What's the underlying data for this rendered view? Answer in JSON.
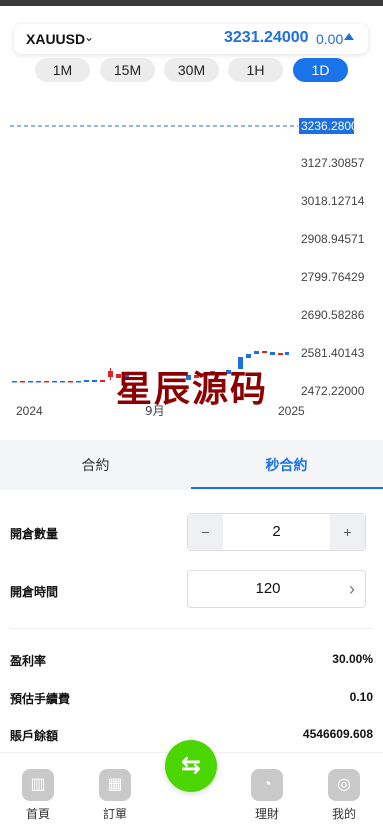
{
  "ticker": {
    "symbol": "XAUUSD",
    "price": "3231.24000",
    "change": "0.00",
    "accent": "#1e6fe0"
  },
  "intervals": [
    {
      "label": "1M",
      "active": false
    },
    {
      "label": "15M",
      "active": false
    },
    {
      "label": "30M",
      "active": false
    },
    {
      "label": "1H",
      "active": false
    },
    {
      "label": "1D",
      "active": true
    }
  ],
  "chart": {
    "current_price_label": "3236.28000",
    "y_ticks": [
      "3127.30857",
      "3018.12714",
      "2908.94571",
      "2799.76429",
      "2690.58286",
      "2581.40143",
      "2472.22000"
    ],
    "x_ticks": [
      "2024",
      "9月",
      "2025"
    ],
    "watermark": "星辰源码"
  },
  "chart_data": {
    "type": "candlestick",
    "ylim": [
      2472.22,
      3236.28
    ],
    "y_ticks": [
      3127.30857,
      3018.12714,
      2908.94571,
      2799.76429,
      2690.58286,
      2581.40143,
      2472.22
    ],
    "current_price": 3236.28,
    "x_ticks": [
      "2024",
      "9月",
      "2025"
    ],
    "up_color": "#1e6fe0",
    "down_color": "#e02424"
  },
  "tabs": [
    {
      "label": "合約",
      "active": false
    },
    {
      "label": "秒合約",
      "active": true
    }
  ],
  "form": {
    "qty_label": "開倉數量",
    "qty_minus": "−",
    "qty_value": "2",
    "qty_plus": "+",
    "time_label": "開倉時間",
    "time_value": "120",
    "time_chevron": "›"
  },
  "info": {
    "profit_rate_label": "盈利率",
    "profit_rate_value": "30.00%",
    "fee_label": "預估手續費",
    "fee_value": "0.10",
    "balance_label": "賬戶餘額",
    "balance_value": "4546609.608"
  },
  "nav": {
    "home": "首頁",
    "orders": "訂單",
    "finance": "理財",
    "mine": "我的"
  },
  "icons": {
    "dropdown": "chevron-down-icon",
    "trend": "triangle-up-icon",
    "swap": "swap-icon"
  }
}
